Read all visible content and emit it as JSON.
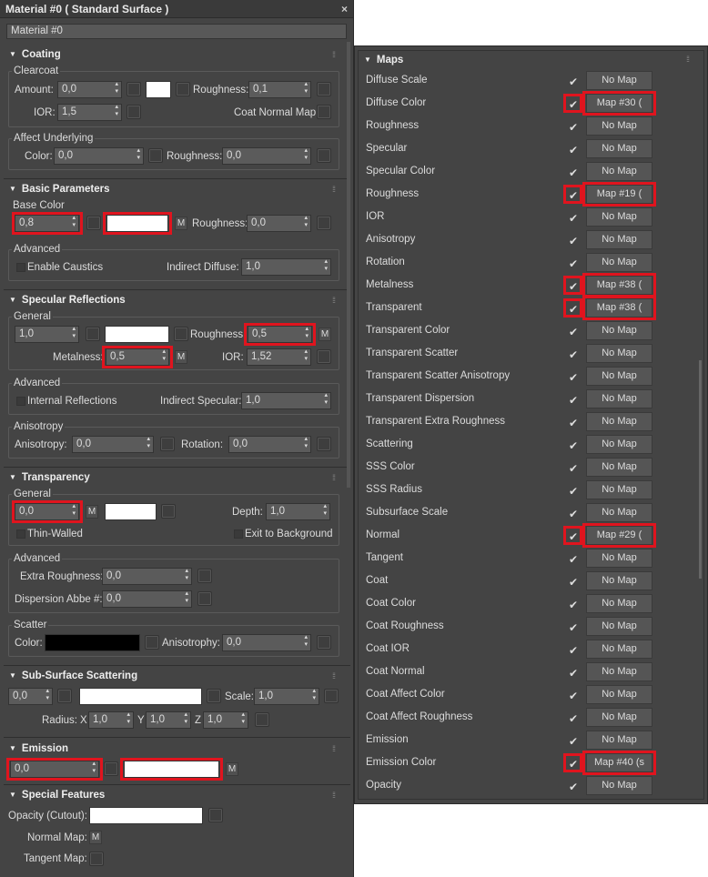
{
  "window": {
    "title": "Material #0  ( Standard Surface )",
    "close_icon": "×",
    "material_name": "Material #0"
  },
  "coating": {
    "title": "Coating",
    "clearcoat_label": "Clearcoat",
    "amount_label": "Amount:",
    "amount": "0,0",
    "roughness_label": "Roughness:",
    "roughness": "0,1",
    "ior_label": "IOR:",
    "ior": "1,5",
    "coat_normal_label": "Coat Normal Map:",
    "affect_label": "Affect Underlying",
    "color_label": "Color:",
    "color": "0,0",
    "aff_rough_label": "Roughness:",
    "aff_rough": "0,0"
  },
  "basic": {
    "title": "Basic Parameters",
    "base_color_label": "Base Color",
    "base": "0,8",
    "m": "M",
    "roughness_label": "Roughness:",
    "roughness": "0,0",
    "advanced_label": "Advanced",
    "caustics_label": "Enable Caustics",
    "indirect_label": "Indirect Diffuse:",
    "indirect": "1,0"
  },
  "specular": {
    "title": "Specular Reflections",
    "general_label": "General",
    "weight": "1,0",
    "roughness_label": "Roughness:",
    "roughness": "0,5",
    "metalness_label": "Metalness:",
    "metalness": "0,5",
    "ior_label": "IOR:",
    "ior": "1,52",
    "m": "M",
    "advanced_label": "Advanced",
    "internal_label": "Internal Reflections",
    "indirect_label": "Indirect Specular:",
    "indirect": "1,0",
    "aniso_group": "Anisotropy",
    "aniso_label": "Anisotropy:",
    "aniso": "0,0",
    "rotation_label": "Rotation:",
    "rotation": "0,0"
  },
  "transparency": {
    "title": "Transparency",
    "general_label": "General",
    "weight": "0,0",
    "m": "M",
    "depth_label": "Depth:",
    "depth": "1,0",
    "thin_label": "Thin-Walled",
    "exit_label": "Exit to Background",
    "advanced_label": "Advanced",
    "extra_label": "Extra Roughness:",
    "extra": "0,0",
    "abbe_label": "Dispersion Abbe #:",
    "abbe": "0,0",
    "scatter_label": "Scatter",
    "color_label": "Color:",
    "anisotrophy_label": "Anisotrophy:",
    "anisotrophy": "0,0"
  },
  "sss": {
    "title": "Sub-Surface Scattering",
    "weight": "0,0",
    "scale_label": "Scale:",
    "scale": "1,0",
    "radius_label": "Radius:",
    "x_label": "X",
    "x": "1,0",
    "y_label": "Y",
    "y": "1,0",
    "z_label": "Z",
    "z": "1,0"
  },
  "emission": {
    "title": "Emission",
    "weight": "0,0",
    "m": "M"
  },
  "special": {
    "title": "Special Features",
    "opacity_label": "Opacity (Cutout):",
    "normal_label": "Normal Map:",
    "m": "M",
    "tangent_label": "Tangent Map:"
  },
  "maps": {
    "title": "Maps",
    "items": [
      {
        "label": "Diffuse Scale",
        "map": "No Map",
        "hl": false
      },
      {
        "label": "Diffuse Color",
        "map": "Map #30 (",
        "hl": true
      },
      {
        "label": "Roughness",
        "map": "No Map",
        "hl": false
      },
      {
        "label": "Specular",
        "map": "No Map",
        "hl": false
      },
      {
        "label": "Specular Color",
        "map": "No Map",
        "hl": false
      },
      {
        "label": "Roughness",
        "map": "Map #19 (",
        "hl": true
      },
      {
        "label": "IOR",
        "map": "No Map",
        "hl": false
      },
      {
        "label": "Anisotropy",
        "map": "No Map",
        "hl": false
      },
      {
        "label": "Rotation",
        "map": "No Map",
        "hl": false
      },
      {
        "label": "Metalness",
        "map": "Map #38 (",
        "hl": true
      },
      {
        "label": "Transparent",
        "map": "Map #38 (",
        "hl": true
      },
      {
        "label": "Transparent Color",
        "map": "No Map",
        "hl": false
      },
      {
        "label": "Transparent Scatter",
        "map": "No Map",
        "hl": false
      },
      {
        "label": "Transparent Scatter Anisotropy",
        "map": "No Map",
        "hl": false
      },
      {
        "label": "Transparent Dispersion",
        "map": "No Map",
        "hl": false
      },
      {
        "label": "Transparent Extra Roughness",
        "map": "No Map",
        "hl": false
      },
      {
        "label": "Scattering",
        "map": "No Map",
        "hl": false
      },
      {
        "label": "SSS Color",
        "map": "No Map",
        "hl": false
      },
      {
        "label": "SSS Radius",
        "map": "No Map",
        "hl": false
      },
      {
        "label": "Subsurface Scale",
        "map": "No Map",
        "hl": false
      },
      {
        "label": "Normal",
        "map": "Map #29 (",
        "hl": true
      },
      {
        "label": "Tangent",
        "map": "No Map",
        "hl": false
      },
      {
        "label": "Coat",
        "map": "No Map",
        "hl": false
      },
      {
        "label": "Coat Color",
        "map": "No Map",
        "hl": false
      },
      {
        "label": "Coat Roughness",
        "map": "No Map",
        "hl": false
      },
      {
        "label": "Coat IOR",
        "map": "No Map",
        "hl": false
      },
      {
        "label": "Coat Normal",
        "map": "No Map",
        "hl": false
      },
      {
        "label": "Coat Affect Color",
        "map": "No Map",
        "hl": false
      },
      {
        "label": "Coat Affect Roughness",
        "map": "No Map",
        "hl": false
      },
      {
        "label": "Emission",
        "map": "No Map",
        "hl": false
      },
      {
        "label": "Emission Color",
        "map": "Map #40 (s",
        "hl": true
      },
      {
        "label": "Opacity",
        "map": "No Map",
        "hl": false
      }
    ]
  },
  "colors": {
    "panel": "#444444",
    "highlight": "#e0141e"
  }
}
